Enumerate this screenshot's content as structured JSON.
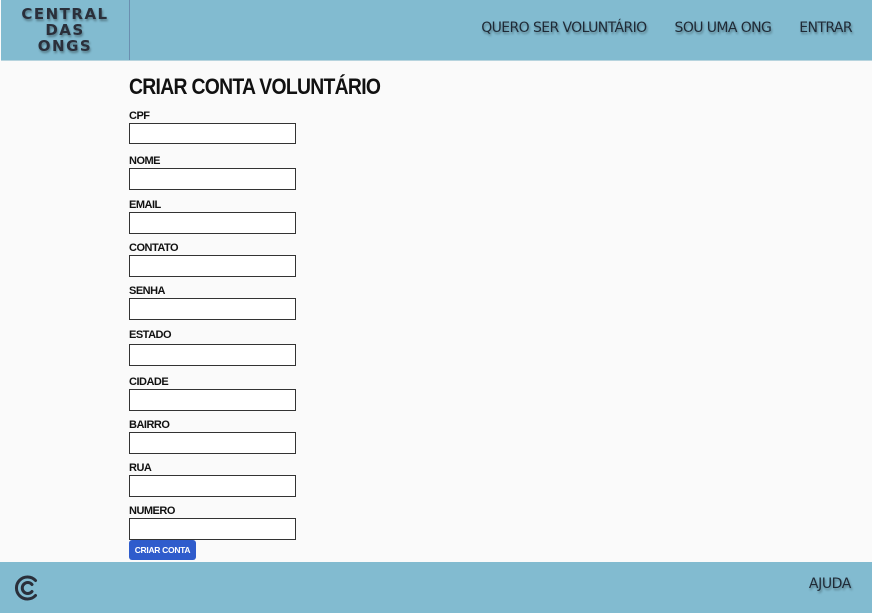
{
  "header": {
    "logo_lines": [
      "CENTRAL",
      "DAS",
      "ONGS"
    ],
    "nav": {
      "volunteer": "QUERO SER VOLUNTÁRIO",
      "ong": "SOU UMA ONG",
      "login": "ENTRAR"
    }
  },
  "form": {
    "title": "CRIAR CONTA VOLUNTÁRIO",
    "fields": [
      {
        "label": "CPF",
        "value": ""
      },
      {
        "label": "NOME",
        "value": ""
      },
      {
        "label": "EMAIL",
        "value": ""
      },
      {
        "label": "CONTATO",
        "value": ""
      },
      {
        "label": "SENHA",
        "value": ""
      },
      {
        "label": "ESTADO",
        "value": ""
      },
      {
        "label": "CIDADE",
        "value": ""
      },
      {
        "label": "BAIRRO",
        "value": ""
      },
      {
        "label": "RUA",
        "value": ""
      },
      {
        "label": "NUMERO",
        "value": ""
      }
    ],
    "submit_label": "CRIAR CONTA"
  },
  "footer": {
    "logo_icon": "central-das-ongs-c-icon",
    "help_label": "AJUDA"
  },
  "colors": {
    "header_bg": "#82bbd0",
    "page_bg": "#fafafa",
    "button_bg": "#2f5ccc"
  }
}
